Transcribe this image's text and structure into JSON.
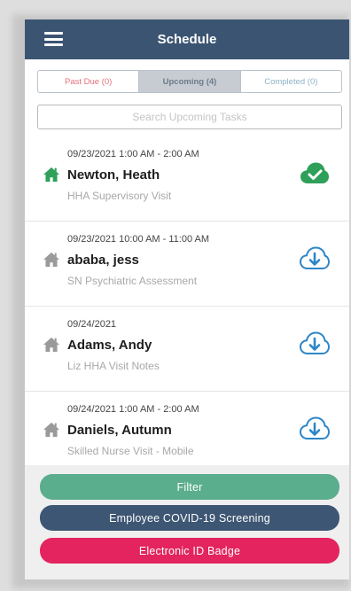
{
  "header": {
    "title": "Schedule"
  },
  "tabs": [
    {
      "label": "Past Due (0)"
    },
    {
      "label": "Upcoming (4)"
    },
    {
      "label": "Completed (0)"
    }
  ],
  "search": {
    "placeholder": "Search Upcoming Tasks",
    "value": ""
  },
  "tasks": [
    {
      "time": "09/23/2021  1:00 AM - 2:00 AM",
      "name": "Newton, Heath",
      "visit_type": "HHA Supervisory Visit",
      "home_icon": "home-icon-green",
      "status_icon": "cloud-check-icon",
      "home_color": "#2fa05a",
      "status_color": "#2fa05a"
    },
    {
      "time": "09/23/2021  10:00 AM - 11:00 AM",
      "name": "ababa, jess",
      "visit_type": "SN Psychiatric Assessment",
      "home_icon": "home-icon-gray",
      "status_icon": "cloud-download-icon",
      "home_color": "#9a9a9a",
      "status_color": "#2d86c8"
    },
    {
      "time": "09/24/2021",
      "name": "Adams, Andy",
      "visit_type": "Liz HHA Visit Notes",
      "home_icon": "home-icon-gray",
      "status_icon": "cloud-download-icon",
      "home_color": "#9a9a9a",
      "status_color": "#2d86c8"
    },
    {
      "time": "09/24/2021  1:00 AM - 2:00 AM",
      "name": "Daniels, Autumn",
      "visit_type": "Skilled Nurse Visit - Mobile",
      "home_icon": "home-icon-gray",
      "status_icon": "cloud-download-icon",
      "home_color": "#9a9a9a",
      "status_color": "#2d86c8"
    }
  ],
  "actions": {
    "filter_label": "Filter",
    "covid_label": "Employee COVID-19 Screening",
    "badge_label": "Electronic ID Badge"
  },
  "colors": {
    "header": "#3b5472",
    "filter": "#5aad8d",
    "covid": "#3d5673",
    "badge": "#e3245e"
  }
}
